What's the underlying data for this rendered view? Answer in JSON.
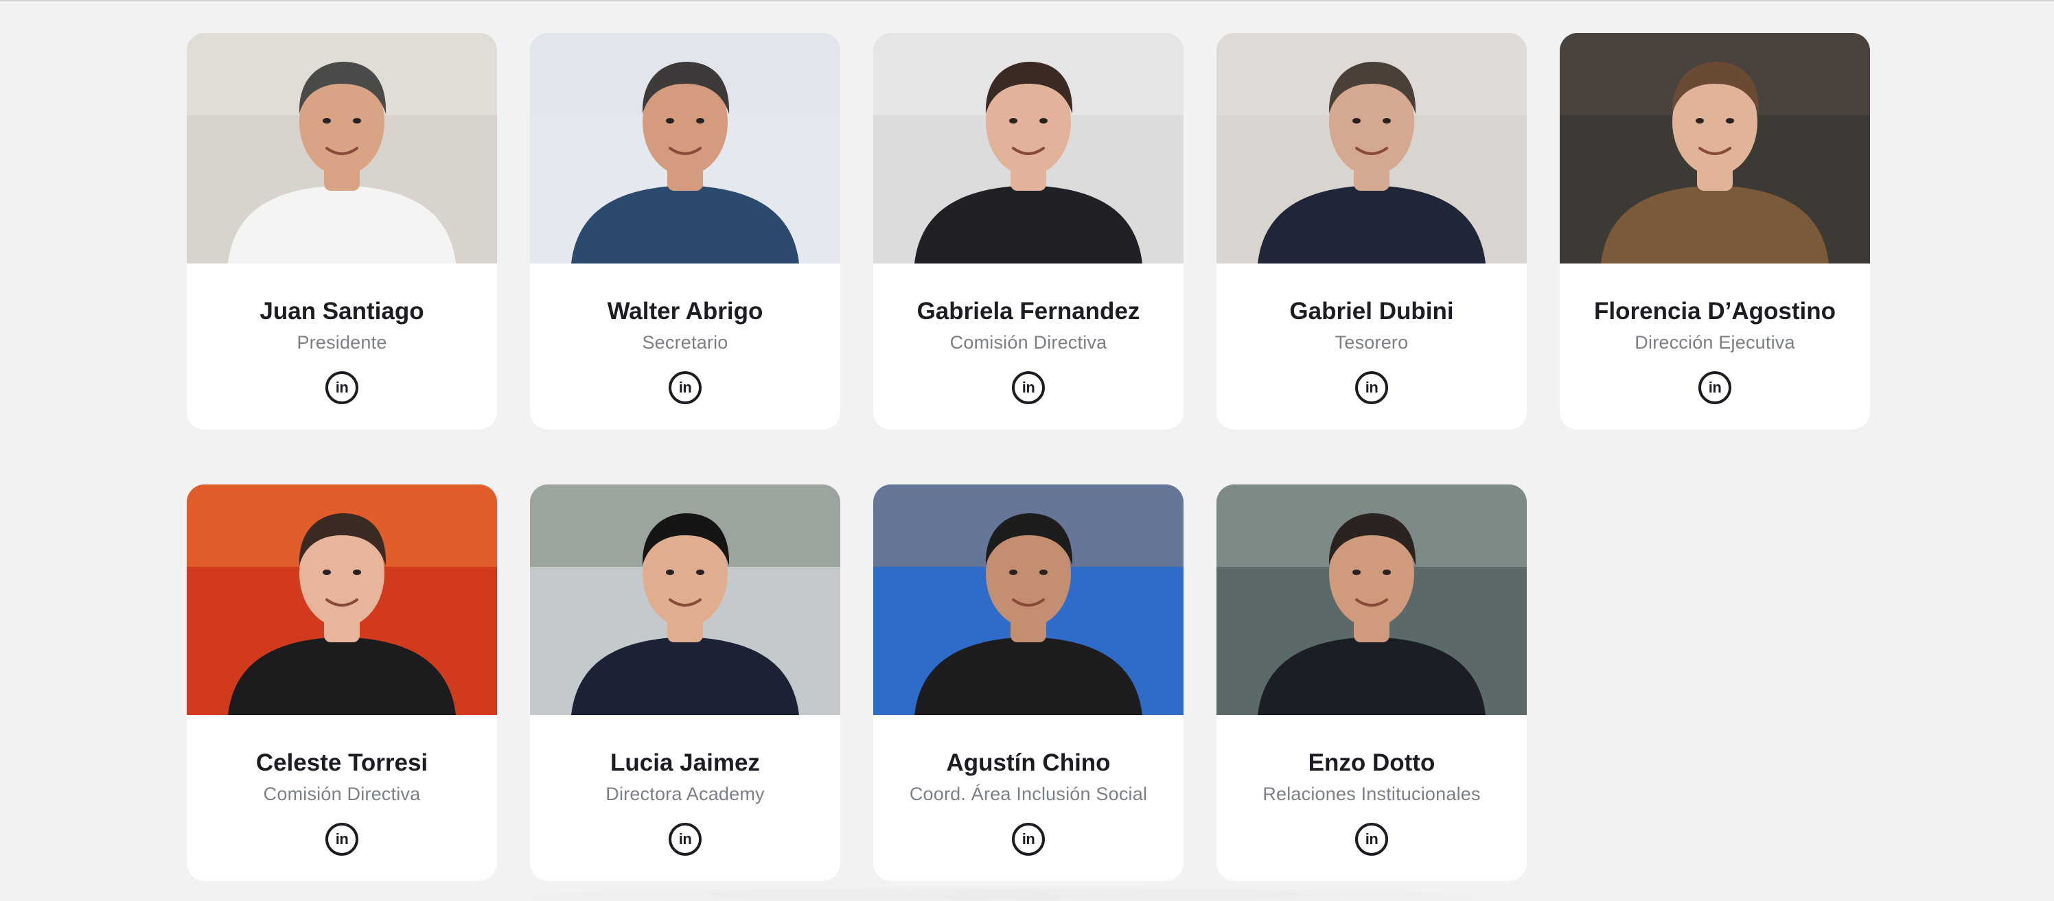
{
  "team": [
    {
      "name": "Juan Santiago",
      "role": "Presidente",
      "linkedin_label": "in",
      "photo": {
        "bg": "#d8d3cc",
        "shirt": "#f4f4f2",
        "skin": "#d9a486",
        "hair": "#4a4a48",
        "accent": "#ece9e4"
      }
    },
    {
      "name": "Walter Abrigo",
      "role": "Secretario",
      "linkedin_label": "in",
      "photo": {
        "bg": "#e6e8ef",
        "shirt": "#2c4a6d",
        "skin": "#d59b7e",
        "hair": "#3e3a39",
        "accent": "#dfe2ea"
      }
    },
    {
      "name": "Gabriela Fernandez",
      "role": "Comisión Directiva",
      "linkedin_label": "in",
      "photo": {
        "bg": "#dcdcdc",
        "shirt": "#1f2126",
        "skin": "#e2b39a",
        "hair": "#3a2a22",
        "accent": "#f0f0f0"
      }
    },
    {
      "name": "Gabriel Dubini",
      "role": "Tesorero",
      "linkedin_label": "in",
      "photo": {
        "bg": "#d9d4cf",
        "shirt": "#1e2638",
        "skin": "#d5a891",
        "hair": "#4b4038",
        "accent": "#e6e2de"
      }
    },
    {
      "name": "Florencia D’Agostino",
      "role": "Dirección Ejecutiva",
      "linkedin_label": "in",
      "photo": {
        "bg": "#3d3a35",
        "shirt": "#7b5a3b",
        "skin": "#e1b49a",
        "hair": "#6b4a33",
        "accent": "#5a5046"
      }
    },
    {
      "name": "Celeste Torresi",
      "role": "Comisión Directiva",
      "linkedin_label": "in",
      "photo": {
        "bg": "#d23a1e",
        "shirt": "#1c1c1e",
        "skin": "#e6b59b",
        "hair": "#3a2a22",
        "accent": "#f58a3c"
      }
    },
    {
      "name": "Lucia Jaimez",
      "role": "Directora Academy",
      "linkedin_label": "in",
      "photo": {
        "bg": "#c4c9cc",
        "shirt": "#1c2235",
        "skin": "#e0ad90",
        "hair": "#151515",
        "accent": "#6d7a63"
      }
    },
    {
      "name": "Agustín Chino",
      "role": "Coord. Área Inclusión Social",
      "linkedin_label": "in",
      "photo": {
        "bg": "#2f6cc9",
        "shirt": "#1d1d20",
        "skin": "#c48f70",
        "hair": "#1d1d1d",
        "accent": "#a8825d"
      }
    },
    {
      "name": "Enzo Dotto",
      "role": "Relaciones Institucionales",
      "linkedin_label": "in",
      "photo": {
        "bg": "#5b6a68",
        "shirt": "#1b1e24",
        "skin": "#d09a7d",
        "hair": "#2b2320",
        "accent": "#a6b2ad"
      }
    }
  ]
}
